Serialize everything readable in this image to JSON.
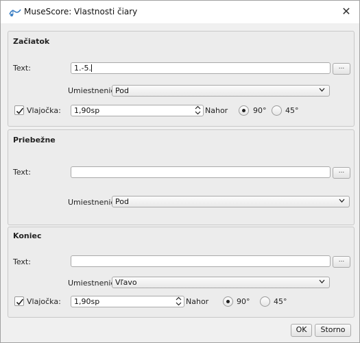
{
  "window": {
    "title": "MuseScore: Vlastnosti čiary",
    "close_glyph": "✕"
  },
  "begin": {
    "title": "Začiatok",
    "text_label": "Text:",
    "text_value": "1.-5.",
    "browse_label": "...",
    "placement_label": "Umiestnenie:",
    "placement_value": "Pod",
    "hook_label": "Vlajočka:",
    "hook_checked": true,
    "hook_value": "1,90sp",
    "up_label": "Nahor",
    "angle_90": "90°",
    "angle_45": "45°",
    "angle_selected": "90°"
  },
  "continue": {
    "title": "Priebežne",
    "text_label": "Text:",
    "text_value": "",
    "browse_label": "...",
    "placement_label": "Umiestnenie:",
    "placement_value": "Pod"
  },
  "end": {
    "title": "Koniec",
    "text_label": "Text:",
    "text_value": "",
    "browse_label": "...",
    "placement_label": "Umiestnenie:",
    "placement_value": "Vľavo",
    "hook_label": "Vlajočka:",
    "hook_checked": true,
    "hook_value": "1,90sp",
    "up_label": "Nahor",
    "angle_90": "90°",
    "angle_45": "45°",
    "angle_selected": "90°"
  },
  "buttons": {
    "ok": "OK",
    "cancel": "Storno"
  }
}
